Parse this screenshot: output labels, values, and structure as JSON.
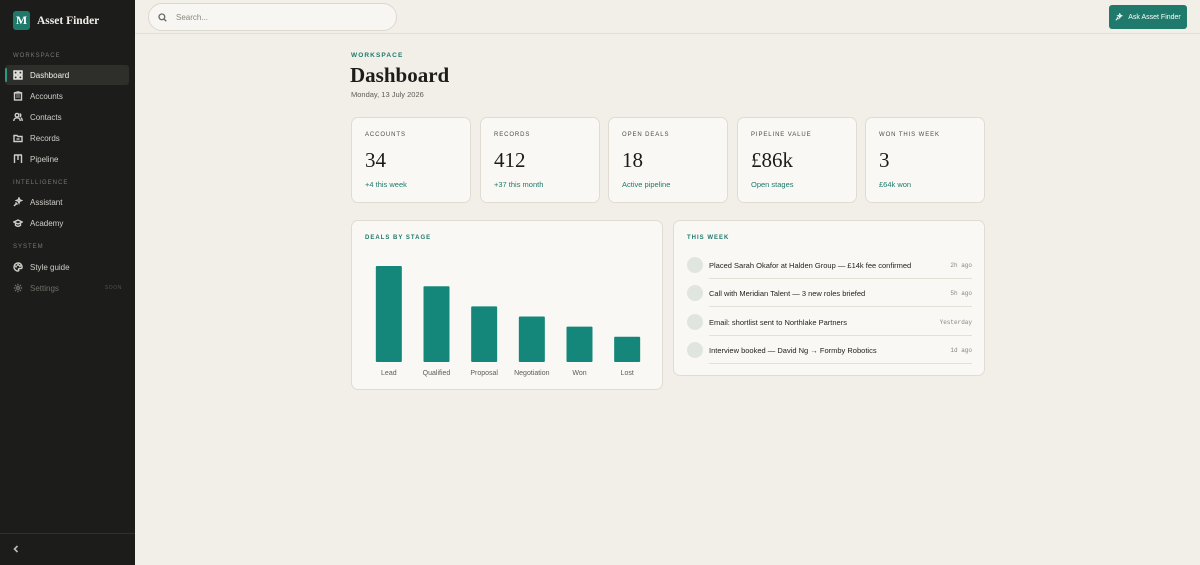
{
  "app": {
    "name": "Asset Finder",
    "logo_letter": "M"
  },
  "sidebar": {
    "sections": [
      {
        "label": "Workspace",
        "items": [
          {
            "label": "Dashboard",
            "icon": "dashboard-icon",
            "active": true
          },
          {
            "label": "Accounts",
            "icon": "building-icon"
          },
          {
            "label": "Contacts",
            "icon": "users-icon"
          },
          {
            "label": "Records",
            "icon": "folder-icon"
          },
          {
            "label": "Pipeline",
            "icon": "pipeline-icon"
          }
        ]
      },
      {
        "label": "Intelligence",
        "items": [
          {
            "label": "Assistant",
            "icon": "sparkle-icon"
          },
          {
            "label": "Academy",
            "icon": "graduation-cap-icon"
          }
        ]
      },
      {
        "label": "System",
        "items": [
          {
            "label": "Style guide",
            "icon": "palette-icon"
          },
          {
            "label": "Settings",
            "icon": "gear-icon",
            "disabled": true,
            "badge": "Soon"
          }
        ]
      }
    ]
  },
  "search": {
    "placeholder": "Search..."
  },
  "ask_button": {
    "label": "Ask Asset Finder"
  },
  "header": {
    "eyebrow": "Workspace",
    "title": "Dashboard",
    "date": "Monday, 13 July 2026"
  },
  "kpis": [
    {
      "label": "Accounts",
      "value": "34",
      "delta": "+4 this week"
    },
    {
      "label": "Records",
      "value": "412",
      "delta": "+37 this month"
    },
    {
      "label": "Open deals",
      "value": "18",
      "delta": "Active pipeline"
    },
    {
      "label": "Pipeline value",
      "value": "£86k",
      "delta": "Open stages"
    },
    {
      "label": "Won this week",
      "value": "3",
      "delta": "£64k won"
    }
  ],
  "deals_card": {
    "title": "Deals by stage"
  },
  "chart_data": {
    "type": "bar",
    "title": "Deals by stage",
    "categories": [
      "Lead",
      "Qualified",
      "Proposal",
      "Negotiation",
      "Won",
      "Lost"
    ],
    "values": [
      19,
      15,
      11,
      9,
      7,
      5
    ],
    "ylim": [
      0,
      19
    ],
    "grid": false,
    "color": "#15877a"
  },
  "activity": {
    "title": "This week",
    "items": [
      {
        "text": "Placed Sarah Okafor at Halden Group — £14k fee confirmed",
        "time": "2h ago"
      },
      {
        "text": "Call with Meridian Talent — 3 new roles briefed",
        "time": "5h ago"
      },
      {
        "text": "Email: shortlist sent to Northlake Partners",
        "time": "Yesterday"
      },
      {
        "text": "Interview booked — David Ng → Formby Robotics",
        "time": "1d ago"
      }
    ]
  },
  "colors": {
    "accent": "#1f7a6c",
    "sidebar_bg": "#1c1c1a",
    "page_bg": "#f2efe9",
    "bar": "#15877a"
  }
}
